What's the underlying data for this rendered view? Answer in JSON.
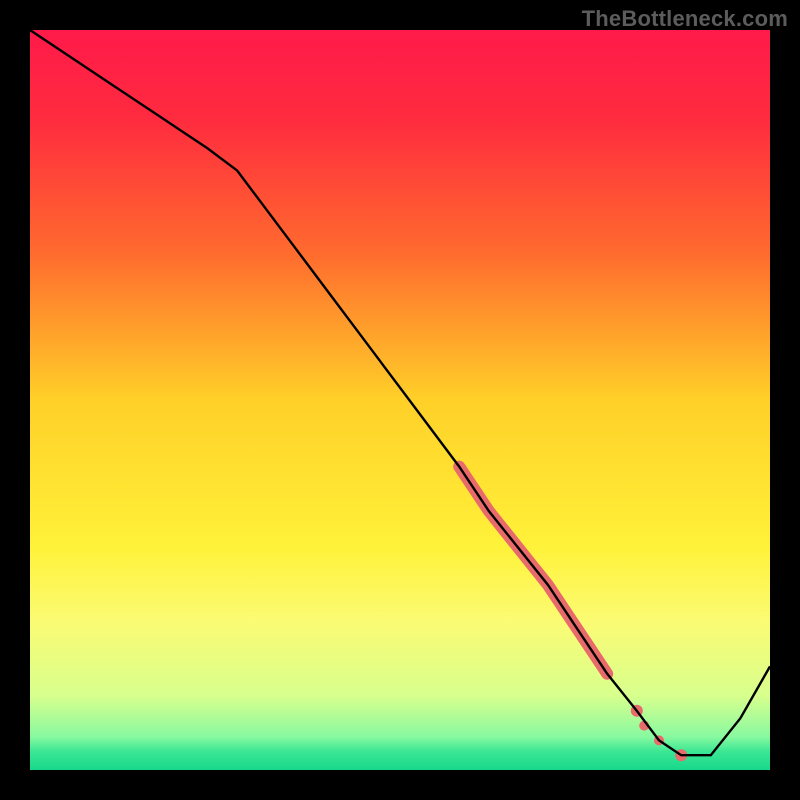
{
  "watermark": "TheBottleneck.com",
  "chart_data": {
    "type": "line",
    "title": "",
    "xlabel": "",
    "ylabel": "",
    "xlim": [
      0,
      100
    ],
    "ylim": [
      0,
      100
    ],
    "grid": false,
    "legend": false,
    "background_gradient_stops": [
      {
        "offset": 0.0,
        "color": "#ff1a4a"
      },
      {
        "offset": 0.12,
        "color": "#ff2b3f"
      },
      {
        "offset": 0.3,
        "color": "#ff6a2e"
      },
      {
        "offset": 0.5,
        "color": "#ffd028"
      },
      {
        "offset": 0.7,
        "color": "#fff23a"
      },
      {
        "offset": 0.8,
        "color": "#fbfb74"
      },
      {
        "offset": 0.9,
        "color": "#d7ff8d"
      },
      {
        "offset": 0.955,
        "color": "#88f9a0"
      },
      {
        "offset": 0.975,
        "color": "#3be794"
      },
      {
        "offset": 1.0,
        "color": "#17d88b"
      }
    ],
    "series": [
      {
        "name": "bottleneck-curve",
        "color": "#000000",
        "width": 2.4,
        "x": [
          0,
          6,
          12,
          18,
          24,
          28,
          34,
          40,
          46,
          52,
          58,
          62,
          66,
          70,
          74,
          78,
          82,
          85,
          88,
          92,
          96,
          100
        ],
        "y": [
          100,
          96,
          92,
          88,
          84,
          81,
          73,
          65,
          57,
          49,
          41,
          35,
          30,
          25,
          19,
          13,
          8,
          4,
          2,
          2,
          7,
          14
        ]
      }
    ],
    "highlight": {
      "name": "highlight-segment",
      "color": "#e86a6a",
      "x": [
        58,
        62,
        66,
        70,
        74,
        78,
        82,
        83,
        85,
        88
      ],
      "y": [
        41,
        35,
        30,
        25,
        19,
        13,
        8,
        6,
        4,
        2
      ],
      "thick_range": {
        "start_index": 0,
        "end_index": 5,
        "width": 12
      },
      "dots": [
        {
          "x": 78,
          "y": 13,
          "r": 5
        },
        {
          "x": 82,
          "y": 8,
          "r": 6
        },
        {
          "x": 83,
          "y": 6,
          "r": 5
        },
        {
          "x": 85,
          "y": 4,
          "r": 5
        },
        {
          "x": 88,
          "y": 2,
          "r": 6
        }
      ]
    }
  }
}
